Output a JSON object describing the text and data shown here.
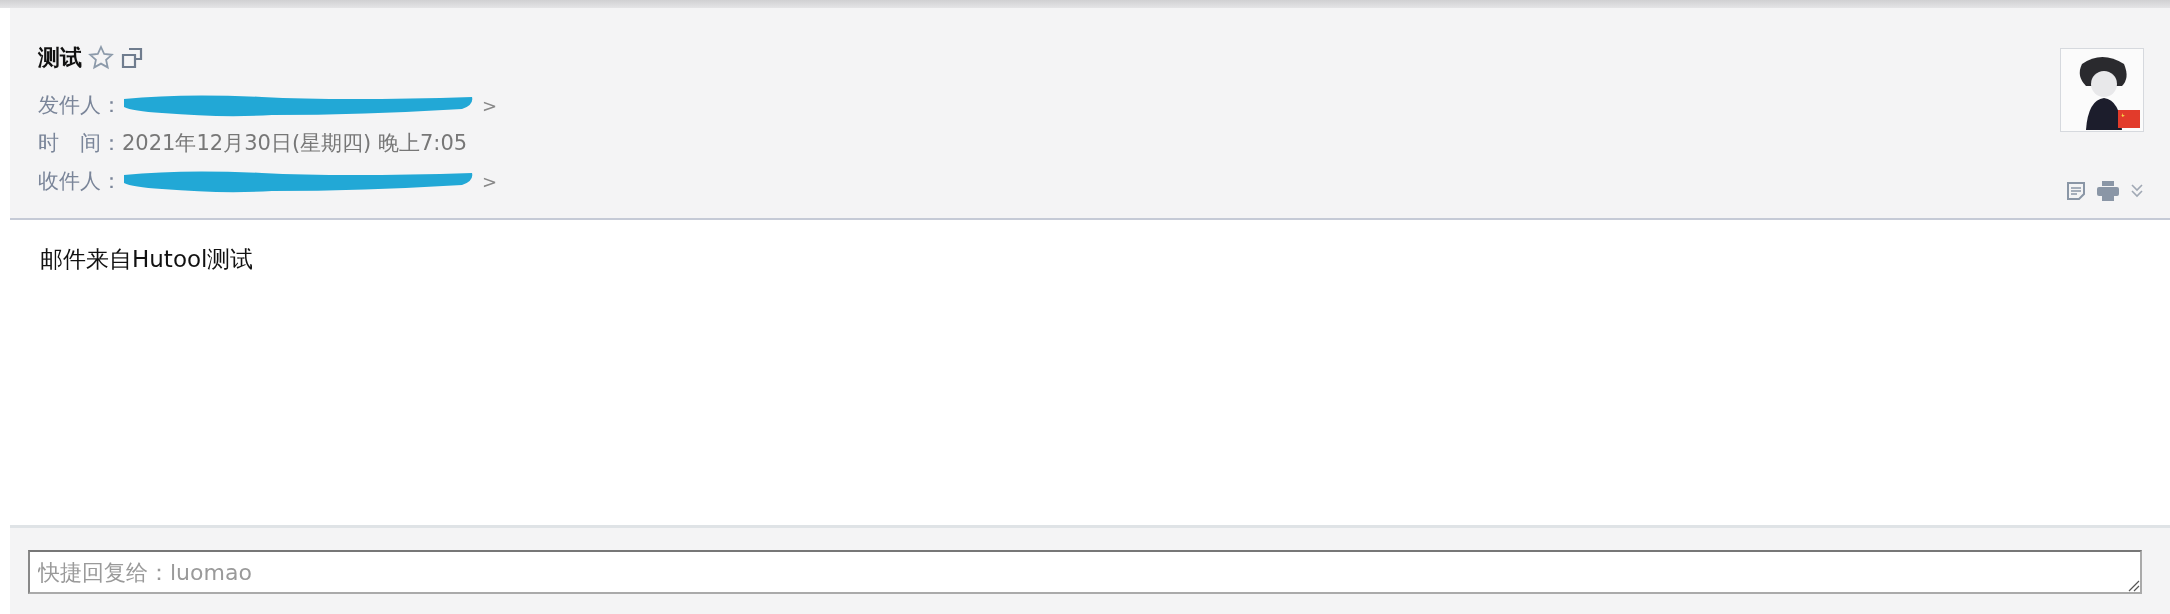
{
  "email": {
    "subject": "测试",
    "starred": false,
    "fields": [
      {
        "kind": "redacted",
        "label": "发件人：",
        "trailing": ">"
      },
      {
        "kind": "text",
        "label": "时　间：",
        "value": "2021年12月30日(星期四) 晚上7:05"
      },
      {
        "kind": "redacted",
        "label": "收件人：",
        "trailing": ">"
      }
    ],
    "body": "邮件来自Hutool测试"
  },
  "quick_reply": {
    "placeholder": "快捷回复给：luomao"
  }
}
